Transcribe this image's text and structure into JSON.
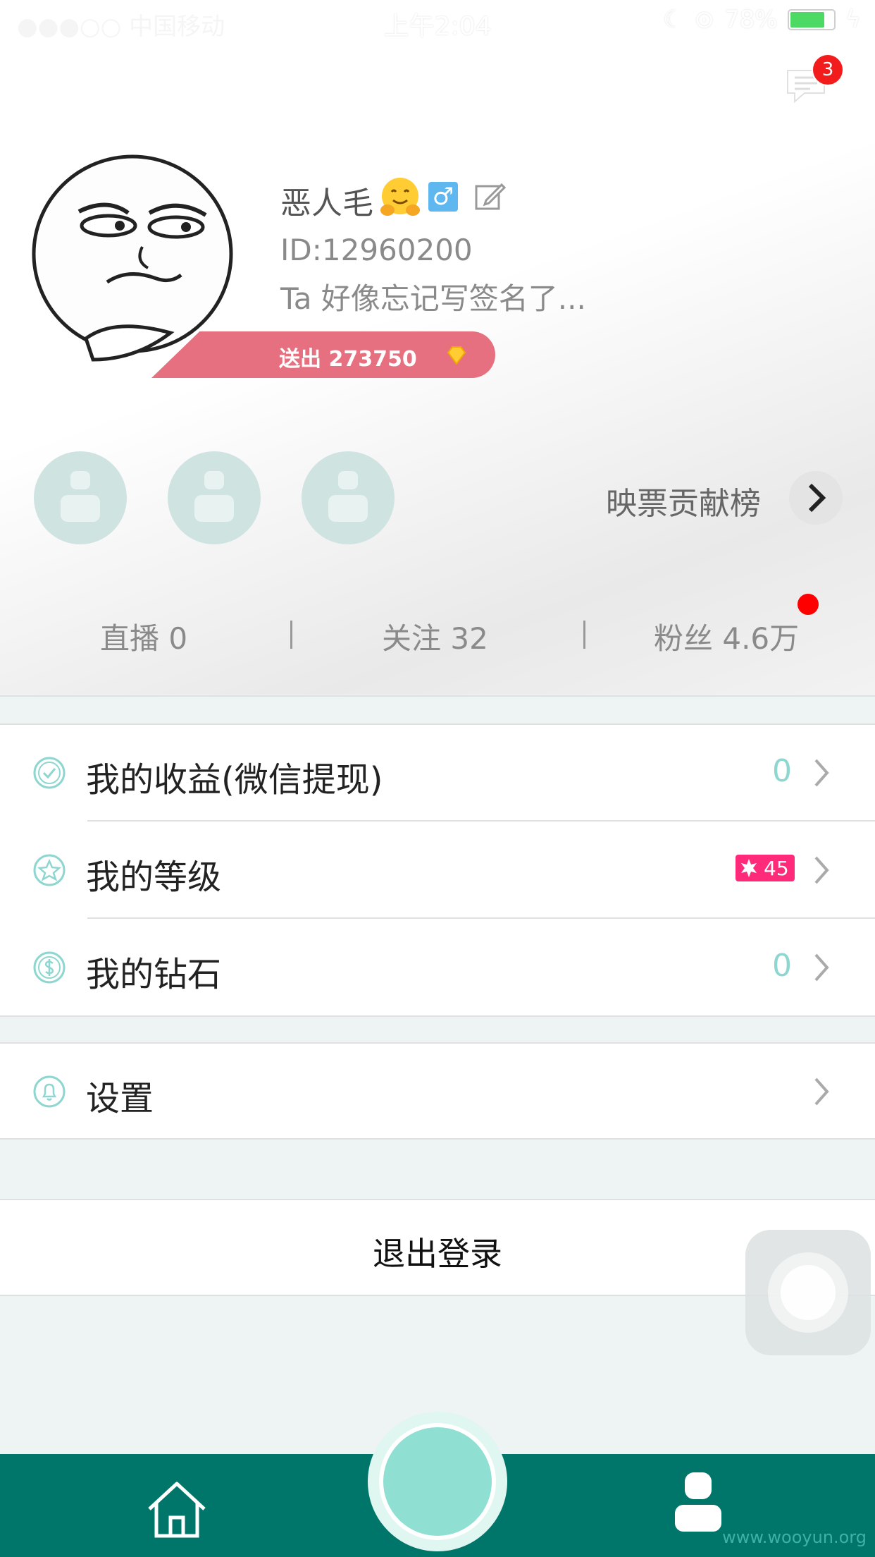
{
  "status_bar": {
    "carrier": "●●●○○ 中国移动",
    "time": "上午2:04",
    "battery": "78%"
  },
  "header": {
    "message_badge": "3"
  },
  "profile": {
    "nickname": "恶人毛",
    "gender_symbol": "♂",
    "id": "ID:12960200",
    "signature": "Ta 好像忘记写签名了...",
    "gift_sent": "送出 273750"
  },
  "contributors": {
    "label": "映票贡献榜"
  },
  "stats": [
    {
      "label": "直播 0"
    },
    {
      "label": "关注 32"
    },
    {
      "label": "粉丝 4.6万"
    }
  ],
  "menu": [
    {
      "label": "我的收益(微信提现)",
      "value": "0",
      "icon": "check-circle-icon"
    },
    {
      "label": "我的等级",
      "value": "45",
      "icon": "star-circle-icon"
    },
    {
      "label": "我的钻石",
      "value": "0",
      "icon": "dollar-circle-icon"
    }
  ],
  "settings": {
    "label": "设置",
    "icon": "bell-icon"
  },
  "logout": {
    "label": "退出登录"
  },
  "tabbar": {
    "items": [
      "home-icon",
      "record-button",
      "profile-icon"
    ]
  },
  "watermark": "www.wooyun.org",
  "colors": {
    "accent": "#00766a",
    "teal_light": "#8fdfd3",
    "gift_pink": "#e6707f",
    "badge_red": "#f21c1c",
    "level_pink": "#ff2a7a"
  }
}
